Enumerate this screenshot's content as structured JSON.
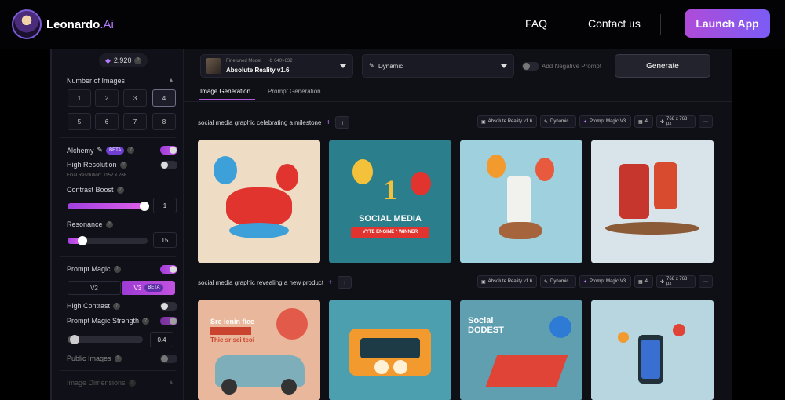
{
  "nav": {
    "brand": "Leonardo",
    "brand_suffix": ".Ai",
    "links": [
      "FAQ",
      "Contact us"
    ],
    "cta": "Launch App",
    "accent": "#b04bd8"
  },
  "sidebar": {
    "tokens": "2,920",
    "num_images": {
      "label": "Number of Images",
      "options": [
        "1",
        "2",
        "3",
        "4",
        "5",
        "6",
        "7",
        "8"
      ],
      "selected": "4"
    },
    "alchemy": {
      "label": "Alchemy",
      "badge": "BETA",
      "on": true
    },
    "high_resolution": {
      "label": "High Resolution",
      "on": false,
      "note": "Final Resolution: 1152 × 768"
    },
    "contrast_boost": {
      "label": "Contrast Boost",
      "value": "1",
      "fraction": 0.98
    },
    "resonance": {
      "label": "Resonance",
      "value": "15",
      "fraction": 0.18
    },
    "prompt_magic": {
      "label": "Prompt Magic",
      "on": true,
      "versions": [
        "V2",
        "V3"
      ],
      "selected": "V3",
      "badge": "BETA"
    },
    "high_contrast": {
      "label": "High Contrast",
      "on": false
    },
    "prompt_magic_strength": {
      "label": "Prompt Magic Strength",
      "value": "0.4",
      "fraction": 0.08
    },
    "public_images": {
      "label": "Public Images",
      "on": false
    },
    "image_dimensions": {
      "label": "Image Dimensions"
    }
  },
  "toolbar": {
    "model_caption": "Finetuned Model",
    "model_size": "640×832",
    "model_name": "Absolute Reality v1.6",
    "style": "Dynamic",
    "negative_prompt": "Add Negative Prompt",
    "generate": "Generate"
  },
  "tabs": [
    "Image Generation",
    "Prompt Generation"
  ],
  "generations": [
    {
      "prompt": "social media graphic celebrating a milestone",
      "chips": [
        "Absolute Reality v1.6",
        "Dynamic",
        "Prompt Magic V3",
        "4",
        "768 x 768 px"
      ],
      "images": [
        {
          "title": "",
          "bg": "#efdcc4",
          "accent": "#e2342f"
        },
        {
          "title": "SOCIAL MEDIA",
          "bg": "#2b7f8c",
          "accent": "#f3c13a"
        },
        {
          "title": "",
          "bg": "#9fd0dd",
          "accent": "#e85a3d"
        },
        {
          "title": "",
          "bg": "#d9e4ea",
          "accent": "#c7362c"
        }
      ],
      "poster_lines": [
        "1",
        "VYTE ENGINE * WINNER"
      ]
    },
    {
      "prompt": "social media graphic revealing a new product",
      "chips": [
        "Absolute Reality v1.6",
        "Dynamic",
        "Prompt Magic V3",
        "4",
        "768 x 768 px"
      ],
      "images": [
        {
          "title": "Sre ienin fiee",
          "bg": "#e9b89c",
          "accent": "#c9432e"
        },
        {
          "title": "",
          "bg": "#4b9fae",
          "accent": "#f29a2e"
        },
        {
          "title": "Social DODEST",
          "bg": "#5f9fb0",
          "accent": "#e04436"
        },
        {
          "title": "",
          "bg": "#b7d6df",
          "accent": "#3a6fd2"
        }
      ],
      "poster_lines": [
        "Thie sr sei teoi"
      ]
    }
  ]
}
